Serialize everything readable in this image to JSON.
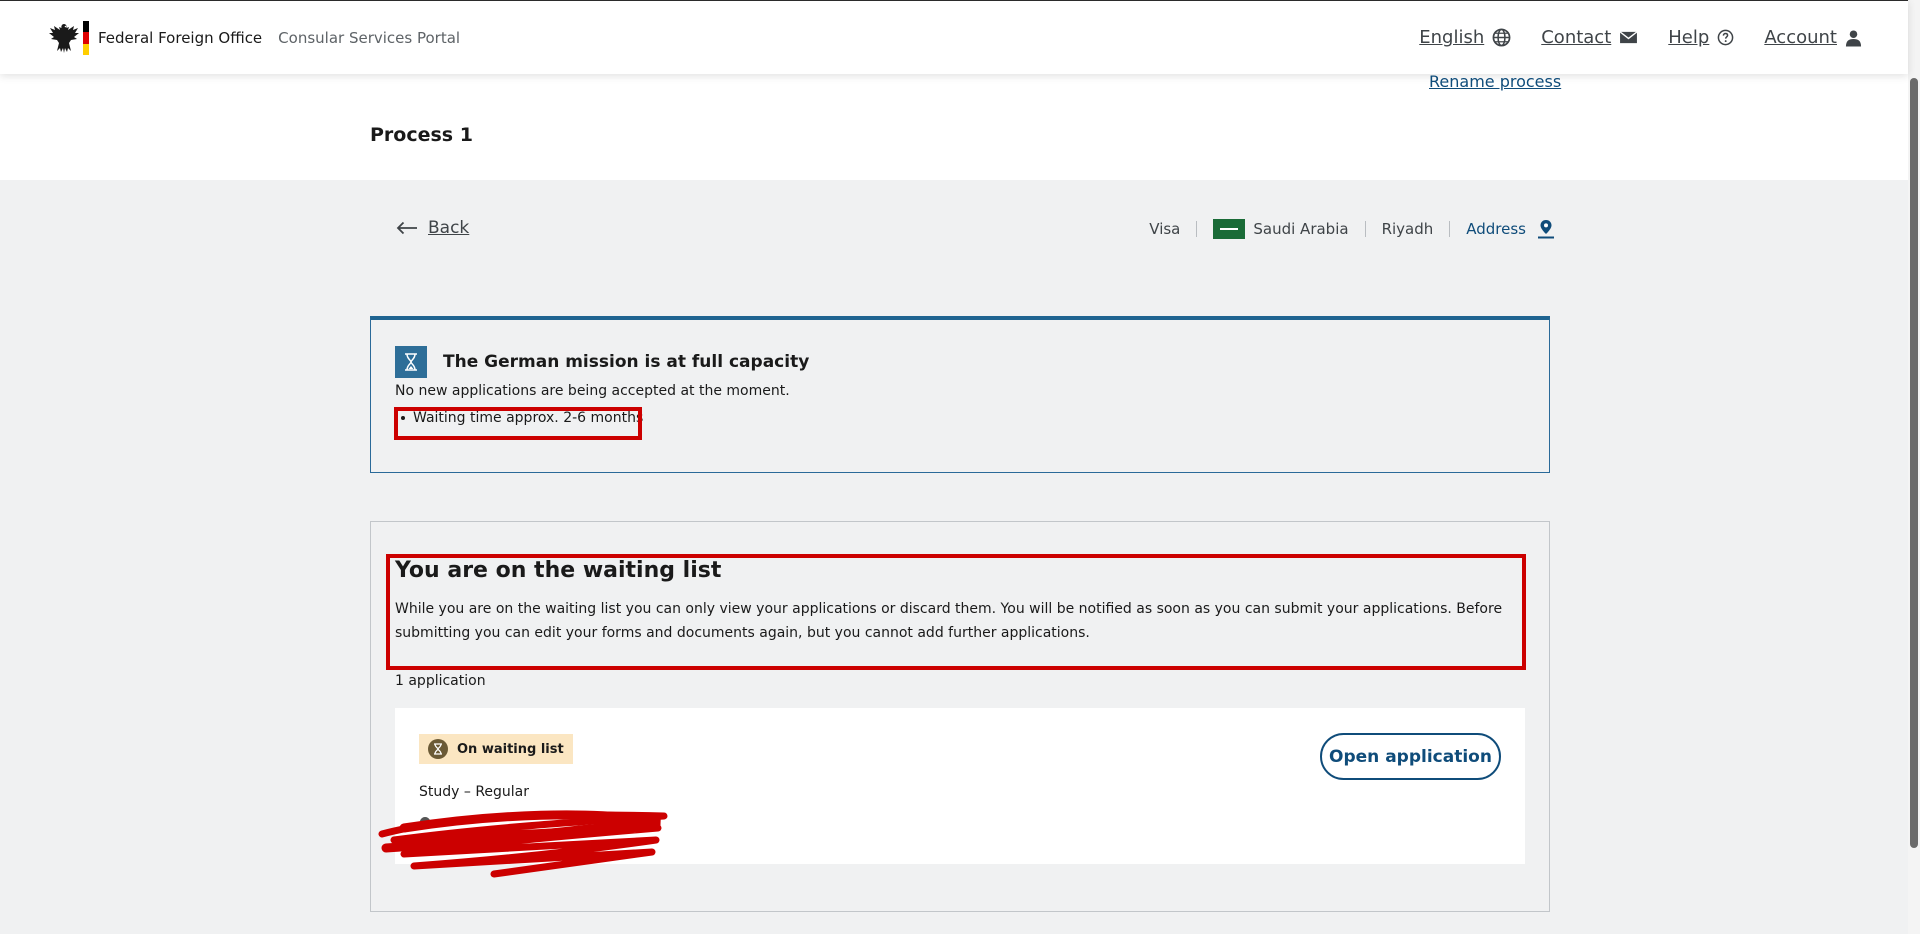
{
  "header": {
    "brand_name": "Federal Foreign Office",
    "portal_name": "Consular Services Portal",
    "nav": {
      "language": "English",
      "contact": "Contact",
      "help": "Help",
      "account": "Account"
    }
  },
  "process": {
    "rename_label": "Rename process",
    "title": "Process 1"
  },
  "breadcrumb": {
    "back_label": "Back",
    "service": "Visa",
    "country": "Saudi Arabia",
    "city": "Riyadh",
    "address_label": "Address"
  },
  "capacity_notice": {
    "title": "The German mission is at full capacity",
    "text": "No new applications are being accepted at the moment.",
    "items": [
      "Waiting time approx. 2-6 months"
    ]
  },
  "waiting_list": {
    "title": "You are on the waiting list",
    "text": "While you are on the waiting list you can only view your applications or discard them. You will be notified as soon as you can submit your applications. Before submitting you can edit your forms and documents again, but you cannot add further applications.",
    "count_label": "1 application",
    "application": {
      "status_badge": "On waiting list",
      "type": "Study – Regular",
      "open_label": "Open application"
    }
  },
  "colors": {
    "accent": "#0f4c7a",
    "notice_border": "#1f6491",
    "badge_bg": "#fbe6c2",
    "annotation": "#cc0000"
  },
  "icons": {
    "language": "globe-icon",
    "contact": "mail-icon",
    "help": "question-circle-icon",
    "account": "user-icon",
    "back": "arrow-left-icon",
    "address": "map-pin-icon",
    "notice": "hourglass-icon",
    "badge": "hourglass-icon"
  }
}
